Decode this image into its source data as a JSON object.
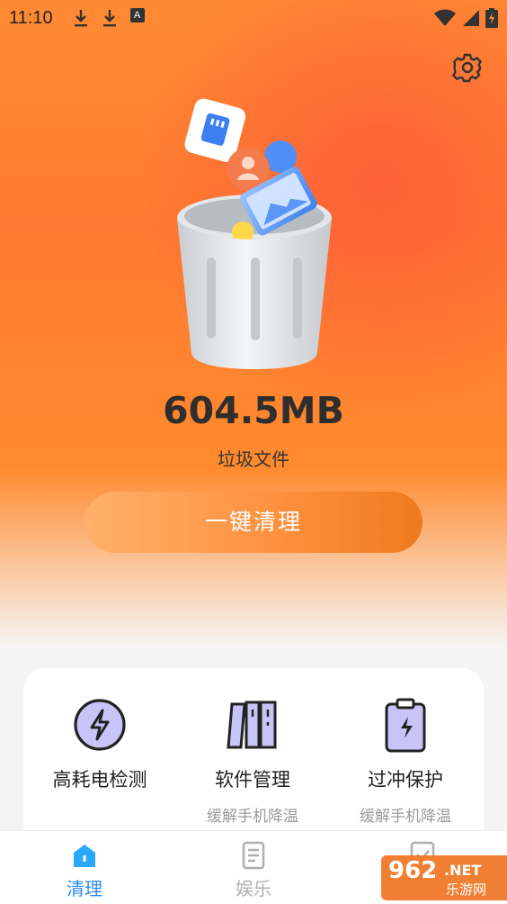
{
  "status_bar": {
    "time": "11:10",
    "icons": [
      "download-icon",
      "download-icon",
      "a-badge-icon",
      "wifi-icon",
      "signal-icon",
      "battery-charging-icon"
    ],
    "a_badge_text": "A"
  },
  "header": {
    "settings_icon": "gear-icon"
  },
  "junk": {
    "amount": "604.5MB",
    "label": "垃圾文件"
  },
  "clean_button": {
    "label": "一键清理"
  },
  "features": [
    {
      "icon": "lightning-circle-icon",
      "title": "高耗电检测",
      "subtitle": ""
    },
    {
      "icon": "books-icon",
      "title": "软件管理",
      "subtitle": "缓解手机降温"
    },
    {
      "icon": "battery-clipboard-icon",
      "title": "过冲保护",
      "subtitle": "缓解手机降温"
    }
  ],
  "tabs": [
    {
      "icon": "home-icon",
      "label": "清理",
      "active": true
    },
    {
      "icon": "document-icon",
      "label": "娱乐",
      "active": false
    },
    {
      "icon": "checkbox-icon",
      "label": "",
      "active": false
    }
  ],
  "watermark": {
    "logo": "962",
    "suffix": ".NET",
    "subtitle": "乐游网"
  },
  "colors": {
    "accent": "#ff8a33",
    "tab_active": "#2d8cf0",
    "tab_inactive": "#b0b0b0"
  }
}
